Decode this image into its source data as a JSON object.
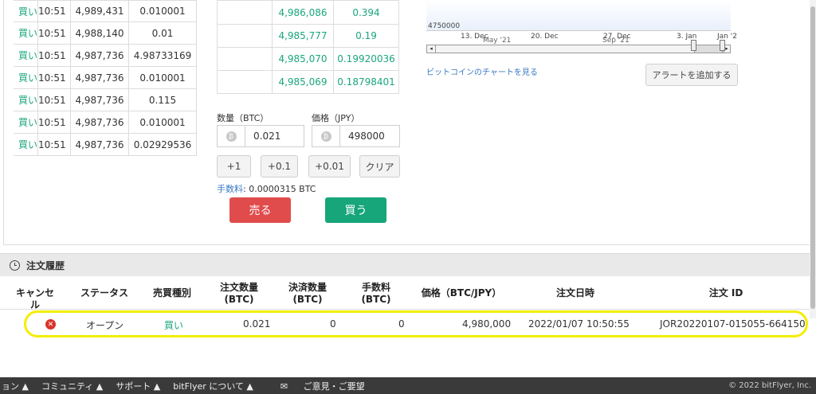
{
  "trades": [
    {
      "side": "買い",
      "time": "10:51",
      "price": "4,989,431",
      "amount": "0.010001"
    },
    {
      "side": "買い",
      "time": "10:51",
      "price": "4,988,140",
      "amount": "0.01"
    },
    {
      "side": "買い",
      "time": "10:51",
      "price": "4,987,736",
      "amount": "4.98733169"
    },
    {
      "side": "買い",
      "time": "10:51",
      "price": "4,987,736",
      "amount": "0.010001"
    },
    {
      "side": "買い",
      "time": "10:51",
      "price": "4,987,736",
      "amount": "0.115"
    },
    {
      "side": "買い",
      "time": "10:51",
      "price": "4,987,736",
      "amount": "0.010001"
    },
    {
      "side": "買い",
      "time": "10:51",
      "price": "4,987,736",
      "amount": "0.02929536"
    }
  ],
  "book": [
    {
      "price": "4,986,086",
      "amount": "0.394"
    },
    {
      "price": "4,985,777",
      "amount": "0.19"
    },
    {
      "price": "4,985,070",
      "amount": "0.19920036"
    },
    {
      "price": "4,985,069",
      "amount": "0.18798401"
    }
  ],
  "chart": {
    "y_label": "4750000",
    "x_labels": [
      "13. Dec",
      "20. Dec",
      "27. Dec",
      "3. Jan",
      "Jan '2"
    ],
    "nav_labels": [
      "May '21",
      "Sep '21"
    ],
    "link": "ビットコインのチャートを見る",
    "alert_button": "アラートを追加する"
  },
  "order": {
    "qty_label": "数量（BTC）",
    "price_label": "価格（JPY）",
    "qty_value": "0.021",
    "price_value": "498000",
    "coin_symbol": "₿",
    "step_buttons": [
      "+1",
      "+0.1",
      "+0.01",
      "クリア"
    ],
    "fee_label": "手数料",
    "fee_value": ": 0.0000315 BTC",
    "sell_label": "売る",
    "buy_label": "買う"
  },
  "history": {
    "title": "注文履歴",
    "headers": [
      "キャンセル",
      "ステータス",
      "売買種別",
      "注文数量\n(BTC)",
      "決済数量\n(BTC)",
      "手数料\n(BTC)",
      "価格（BTC/JPY）",
      "注文日時",
      "注文 ID"
    ],
    "row": {
      "status": "オープン",
      "side": "買い",
      "qty": "0.021",
      "settled": "0",
      "fee": "0",
      "price": "4,980,000",
      "datetime": "2022/01/07 10:50:55",
      "order_id": "JOR20220107-015055-664150"
    }
  },
  "footer": {
    "items": [
      "ョン ▲",
      "コミュニティ ▲",
      "サポート ▲",
      "bitFlyer について ▲"
    ],
    "feedback": "ご意見・ご要望",
    "copyright": "© 2022 bitFlyer, Inc."
  },
  "colors": {
    "buy": "#17a57a",
    "sell": "#e04c4c",
    "link": "#3a78c3",
    "highlight": "#f2ee00"
  }
}
